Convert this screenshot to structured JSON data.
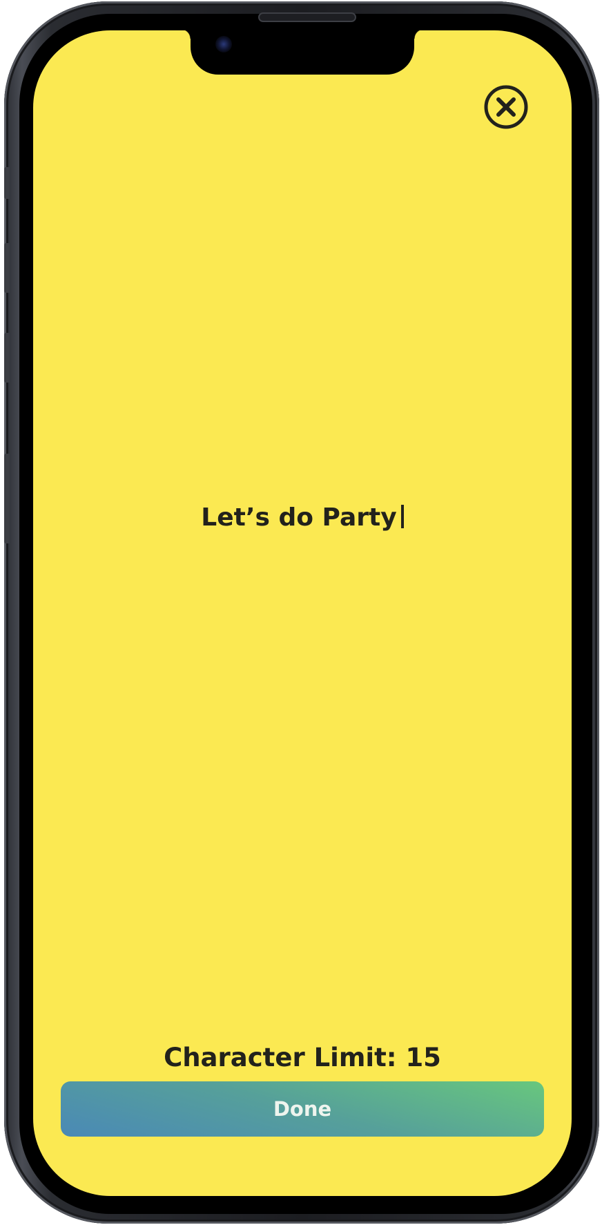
{
  "editor": {
    "text": "Let’s do Party",
    "character_limit_label": "Character Limit: 15"
  },
  "actions": {
    "close_icon": "close-circle-icon",
    "done_label": "Done"
  },
  "colors": {
    "background": "#fbe952",
    "text": "#22221c",
    "done_gradient_start": "#4a89b6",
    "done_gradient_end": "#68c77d"
  }
}
